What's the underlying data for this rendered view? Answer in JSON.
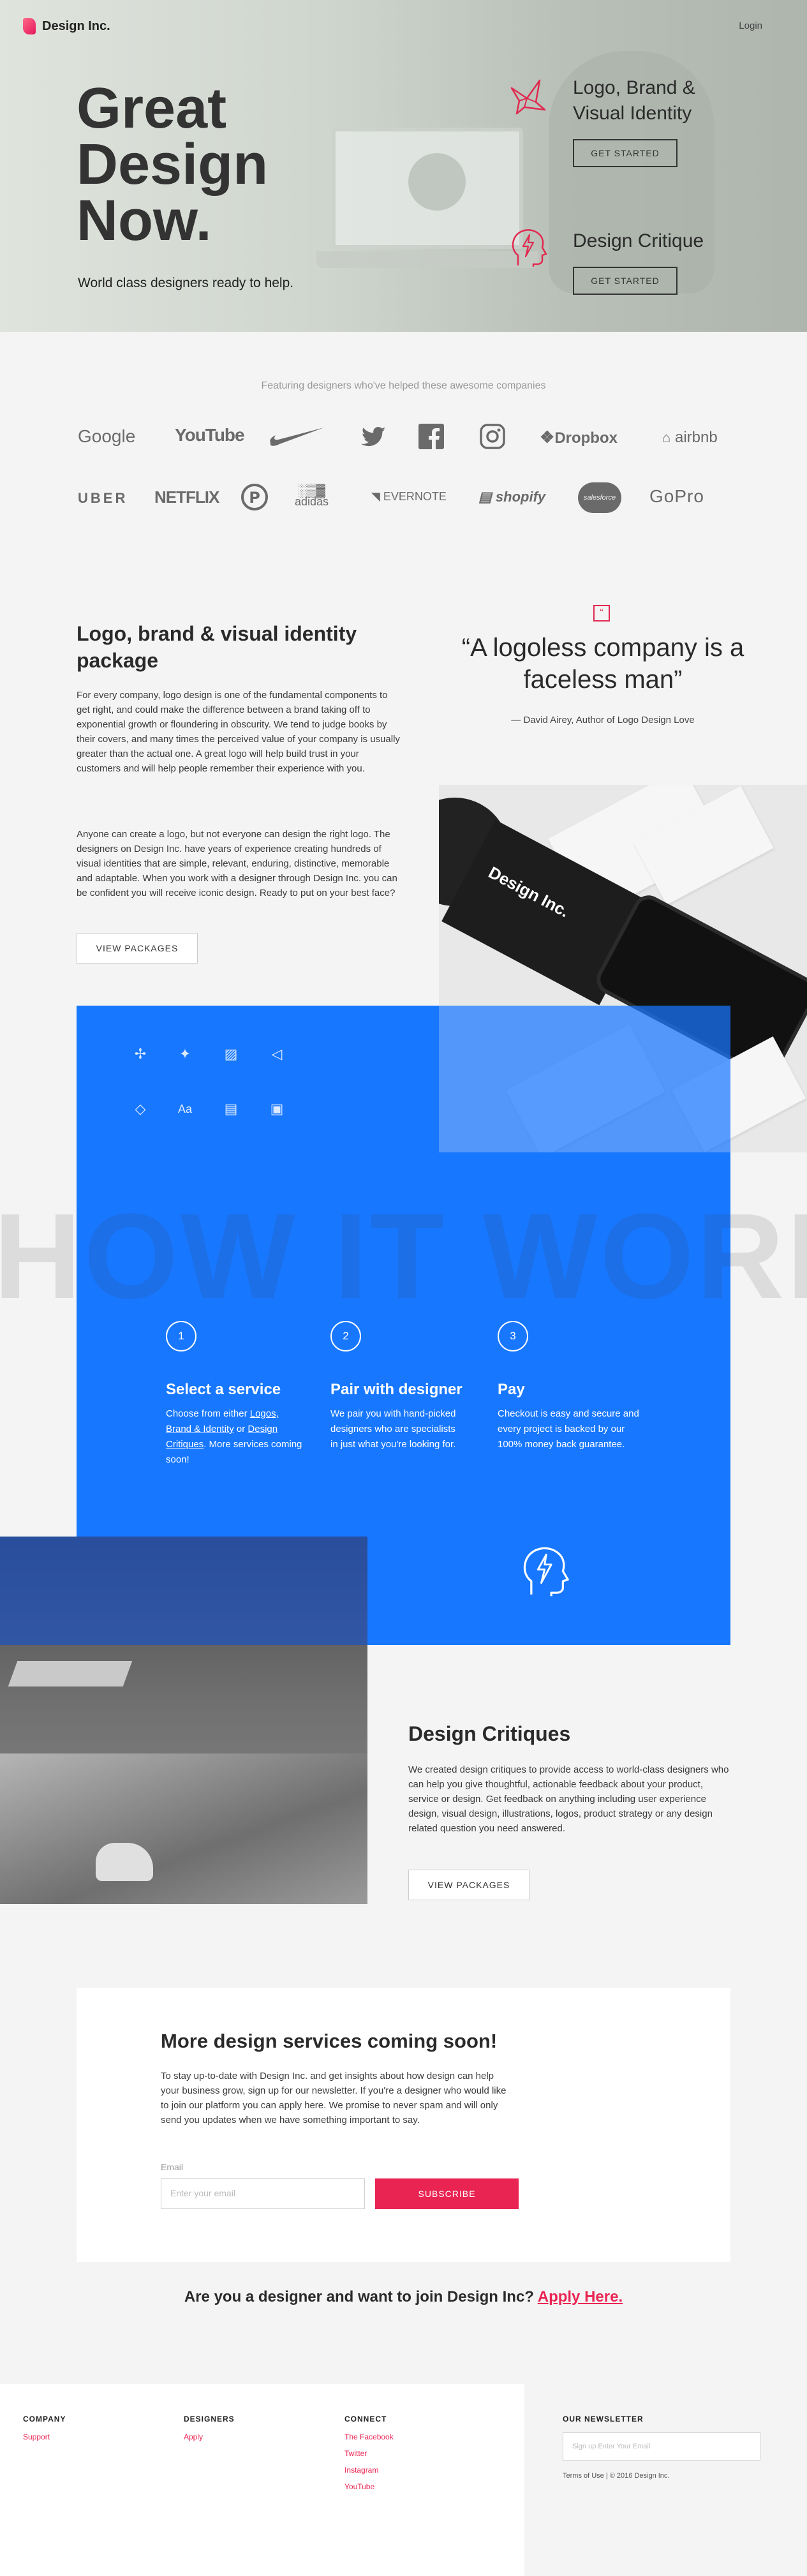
{
  "header": {
    "brand": "Design Inc.",
    "login": "Login"
  },
  "hero": {
    "title_line1": "Great",
    "title_line2": "Design",
    "title_line3": "Now.",
    "subtitle": "World class designers ready to help.",
    "services": [
      {
        "title_line1": "Logo, Brand &",
        "title_line2": "Visual Identity",
        "button": "GET STARTED"
      },
      {
        "title_line1": "Design Critique",
        "button": "GET STARTED"
      }
    ]
  },
  "companies": {
    "heading": "Featuring designers who've helped these awesome companies",
    "row1": [
      "Google",
      "YouTube",
      "Nike",
      "Twitter",
      "Facebook",
      "Instagram",
      "Dropbox",
      "airbnb"
    ],
    "row2": [
      "UBER",
      "NETFLIX",
      "Pinterest",
      "adidas",
      "EVERNOTE",
      "shopify",
      "salesforce",
      "GoPro"
    ]
  },
  "logo_section": {
    "title": "Logo, brand & visual identity package",
    "para1": "For every company, logo design is one of the fundamental components to get right, and could make the difference between a brand taking off to exponential growth or floundering in obscurity. We tend to judge books by their covers, and many times the perceived value of your company is usually greater than the actual one. A great logo will help build trust in your customers and will help people remember their experience with you.",
    "para2": "Anyone can create a logo, but not everyone can design the right logo. The designers on Design Inc. have years of experience creating hundreds of visual identities that are simple, relevant, enduring, distinctive, memorable and adaptable. When you work with a designer through Design Inc. you can be confident you will receive iconic design. Ready to put on your best face?",
    "button": "VIEW PACKAGES",
    "quote": "“A logoless company is a faceless man”",
    "quote_author": "— David Airey, Author of Logo Design Love",
    "mockup_text": "Design Inc."
  },
  "how": {
    "watermark": "HOW IT WORKS",
    "steps": [
      {
        "num": "1",
        "title": "Select a service",
        "text_before": "Choose from either ",
        "link1": "Logos, Brand & Identity",
        "text_mid": " or ",
        "link2": "Design Critiques",
        "text_after": ". More services coming soon!"
      },
      {
        "num": "2",
        "title": "Pair with designer",
        "text": "We pair you with hand-picked designers who are specialists in just what you're looking for."
      },
      {
        "num": "3",
        "title": "Pay",
        "text": "Checkout is easy and secure and every project is backed by our 100% money back guarantee."
      }
    ]
  },
  "critiques": {
    "title": "Design Critiques",
    "text": "We created design critiques to provide access to world-class designers who can help you give thoughtful, actionable feedback about your product, service or design. Get feedback on anything including user experience design, visual design, illustrations, logos, product strategy or any design related question you need answered.",
    "button": "VIEW PACKAGES"
  },
  "newsletter": {
    "title": "More design services coming soon!",
    "text": "To stay up-to-date with Design Inc. and get insights about how design can help your business grow, sign up for our newsletter. If you're a designer who would like to join our platform you can apply here. We promise to never spam and will only send you updates when we have something important to say.",
    "email_label": "Email",
    "email_placeholder": "Enter your email",
    "button": "SUBSCRIBE"
  },
  "join": {
    "text": "Are you a designer and want to join Design Inc? ",
    "link": "Apply Here."
  },
  "footer": {
    "company": {
      "heading": "COMPANY",
      "links": [
        "Support"
      ]
    },
    "designers": {
      "heading": "DESIGNERS",
      "links": [
        "Apply"
      ]
    },
    "connect": {
      "heading": "CONNECT",
      "links": [
        "The Facebook",
        "Twitter",
        "Instagram",
        "YouTube"
      ]
    },
    "newsletter": {
      "heading": "OUR NEWSLETTER",
      "placeholder": "Sign up Enter Your Email"
    },
    "fine_print": "Terms of Use | © 2016 Design Inc."
  },
  "colors": {
    "accent": "#ea2452",
    "blue": "#1777ff",
    "text": "#2a2a2a"
  }
}
